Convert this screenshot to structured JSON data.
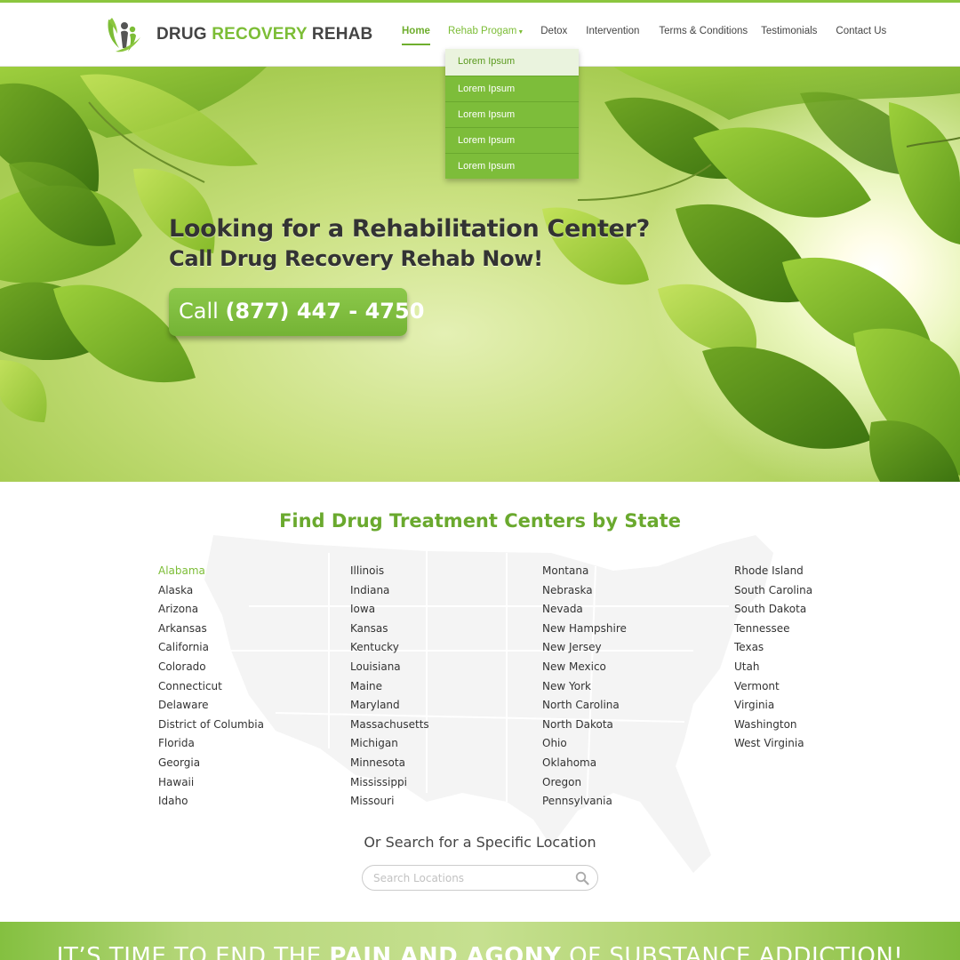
{
  "brand": {
    "name_part1": "DRUG ",
    "name_part2": "RECOVERY",
    "name_part3": " REHAB",
    "logo_icon": "people-leaf-logo-icon",
    "accent_color": "#7cbd36"
  },
  "nav": {
    "items": [
      {
        "label": "Home",
        "active": true
      },
      {
        "label": "Rehab Progam",
        "has_dropdown": true
      },
      {
        "label": "Detox"
      },
      {
        "label": "Intervention"
      },
      {
        "label": "Terms & Conditions"
      },
      {
        "label": "Testimonials"
      },
      {
        "label": "Contact Us"
      }
    ],
    "dropdown": [
      "Lorem Ipsum",
      "Lorem Ipsum",
      "Lorem Ipsum",
      "Lorem Ipsum",
      "Lorem Ipsum"
    ]
  },
  "hero": {
    "line1": "Looking for a Rehabilitation Center?",
    "line2": "Call Drug Recovery Rehab Now!",
    "call_prefix": "Call ",
    "phone": "(877) 447 - 4750"
  },
  "states": {
    "title": "Find Drug Treatment Centers by State",
    "columns": [
      [
        "Alabama",
        "Alaska",
        "Arizona",
        "Arkansas",
        "California",
        "Colorado",
        "Connecticut",
        "Delaware",
        "District of Columbia",
        "Florida",
        "Georgia",
        "Hawaii",
        "Idaho"
      ],
      [
        "Illinois",
        "Indiana",
        "Iowa",
        "Kansas",
        "Kentucky",
        "Louisiana",
        "Maine",
        "Maryland",
        "Massachusetts",
        "Michigan",
        "Minnesota",
        "Mississippi",
        "Missouri"
      ],
      [
        "Montana",
        "Nebraska",
        "Nevada",
        "New Hampshire",
        "New Jersey",
        "New Mexico",
        "New York",
        "North Carolina",
        "North Dakota",
        "Ohio",
        "Oklahoma",
        "Oregon",
        "Pennsylvania"
      ],
      [
        "Rhode Island",
        "South Carolina",
        "South Dakota",
        "Tennessee",
        "Texas",
        "Utah",
        "Vermont",
        "Virginia",
        "Washington",
        "West Virginia"
      ]
    ],
    "active_state": "Alabama",
    "search_label": "Or Search for a Specific Location",
    "search_placeholder": "Search Locations",
    "search_value": ""
  },
  "banner": {
    "part1": "IT’S TIME TO END THE ",
    "part2": "PAIN AND AGONY",
    "part3": " OF SUBSTANCE ADDICTION!"
  }
}
